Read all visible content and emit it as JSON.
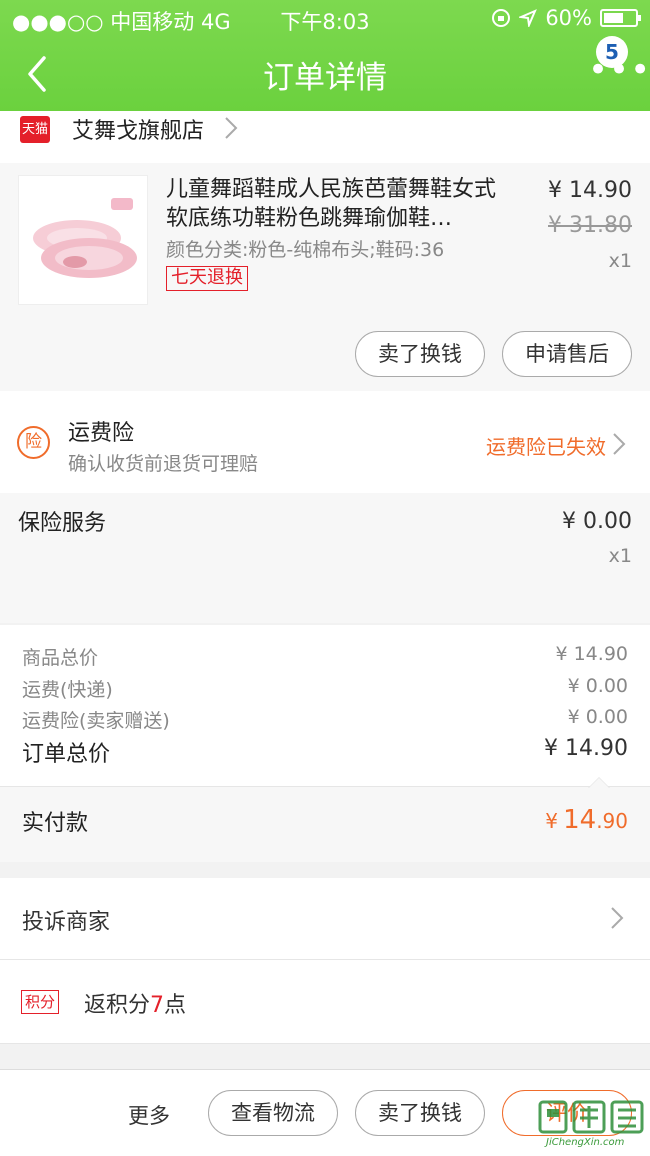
{
  "status_bar": {
    "carrier": "●●●○○ 中国移动   4G",
    "time": "下午8:03",
    "battery": "60%"
  },
  "nav": {
    "title": "订单详情",
    "more_badge": "5"
  },
  "shop": {
    "badge": "天猫",
    "name": "艾舞戈旗舰店"
  },
  "product": {
    "title": "儿童舞蹈鞋成人民族芭蕾舞鞋女式软底练功鞋粉色跳舞瑜伽鞋…",
    "spec": "颜色分类:粉色-纯棉布头;鞋码:36",
    "tag": "七天退换",
    "price": "¥ 14.90",
    "original_price": "¥ 31.80",
    "quantity": "x1",
    "actions": [
      "卖了换钱",
      "申请售后"
    ]
  },
  "insurance": {
    "icon_char": "险",
    "title": "运费险",
    "subtitle": "确认收货前退货可理赔",
    "status": "运费险已失效"
  },
  "insurance_service": {
    "title": "保险服务",
    "price": "¥ 0.00",
    "quantity": "x1"
  },
  "totals": {
    "rows": [
      {
        "label": "商品总价",
        "value": "¥ 14.90"
      },
      {
        "label": "运费(快递)",
        "value": "¥ 0.00"
      },
      {
        "label": "运费险(卖家赠送)",
        "value": "¥ 0.00"
      }
    ],
    "order_total_label": "订单总价",
    "order_total_value": "¥ 14.90"
  },
  "paid": {
    "label": "实付款",
    "currency": "¥",
    "integer": "14",
    "decimal": ".90"
  },
  "complain": {
    "label": "投诉商家"
  },
  "points": {
    "badge": "积分",
    "prefix": "返积分",
    "value": "7",
    "suffix": "点"
  },
  "bottom_bar": {
    "more": "更多",
    "buttons": [
      "查看物流",
      "卖了换钱",
      "评价"
    ]
  },
  "watermark": {
    "text": "JiChengXin.com"
  },
  "colors": {
    "header_green": "#6bd13e",
    "accent_orange": "#f06c2b",
    "tmall_red": "#e4202a"
  }
}
